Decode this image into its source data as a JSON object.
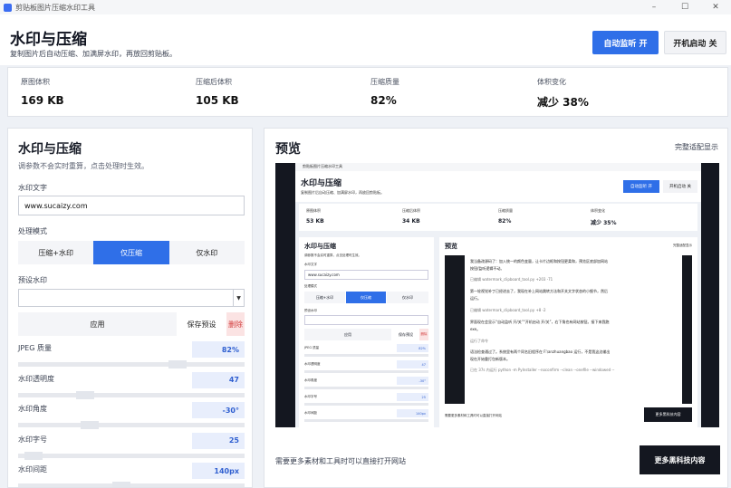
{
  "window": {
    "title": "剪贴板图片压缩水印工具",
    "controls": [
      "–",
      "☐",
      "✕"
    ]
  },
  "header": {
    "title": "水印与压缩",
    "subtitle": "复制图片后自动压缩、加满屏水印，再放回剪贴板。",
    "auto_listen_label": "自动监听  开",
    "boot_label": "开机启动  关"
  },
  "stats": [
    {
      "label": "原图体积",
      "value": "169 KB"
    },
    {
      "label": "压缩后体积",
      "value": "105 KB"
    },
    {
      "label": "压缩质量",
      "value": "82%"
    },
    {
      "label": "体积变化",
      "value": "减少 38%"
    }
  ],
  "left": {
    "title": "水印与压缩",
    "subtitle": "调参数不会实时重算，点击处理时生效。",
    "watermark_text_label": "水印文字",
    "watermark_text_value": "www.sucaizy.com",
    "mode_label": "处理模式",
    "modes": [
      "压缩+水印",
      "仅压缩",
      "仅水印"
    ],
    "active_mode": 1,
    "preset_label": "预设水印",
    "preset_value": "",
    "apply_label": "应用",
    "save_preset_label": "保存预设",
    "delete_label": "删除",
    "sliders": [
      {
        "label": "JPEG 质量",
        "value": "82%",
        "level": 0.72
      },
      {
        "label": "水印透明度",
        "value": "47",
        "level": 0.28
      },
      {
        "label": "水印角度",
        "value": "-30°",
        "level": 0.3
      },
      {
        "label": "水印字号",
        "value": "25",
        "level": 0.03
      },
      {
        "label": "水印间距",
        "value": "140px",
        "level": 0.45
      }
    ]
  },
  "right": {
    "title": "预览",
    "fit_label": "完整适配显示",
    "footer_text": "需要更多素材和工具时可以直接打开网站",
    "more_button": "更多黑科技内容"
  },
  "mini": {
    "window_title": "剪贴板图片压缩水印工具",
    "title": "水印与压缩",
    "subtitle": "复制图片后自动压缩、加满屏水印，再放回剪贴板。",
    "auto_listen_label": "自动监听  开",
    "boot_label": "开机启动  关",
    "stats": [
      {
        "label": "原图体积",
        "value": "53 KB"
      },
      {
        "label": "压缩后体积",
        "value": "34 KB"
      },
      {
        "label": "压缩质量",
        "value": "82%"
      },
      {
        "label": "体积变化",
        "value": "减少 35%"
      }
    ],
    "left_title": "水印与压缩",
    "left_sub": "调参数不会实时重算，点击处理时生效。",
    "text_label": "水印文字",
    "text_value": "www.sucaizy.com",
    "mode_label": "处理模式",
    "modes": [
      "压缩+水印",
      "仅压缩",
      "仅水印"
    ],
    "preset_label": "预设水印",
    "apply": "应用",
    "save": "保存预设",
    "del": "删除",
    "sliders": [
      {
        "label": "JPEG 质量",
        "value": "82%"
      },
      {
        "label": "水印透明度",
        "value": "47"
      },
      {
        "label": "水印角度",
        "value": "-30°"
      },
      {
        "label": "水印字号",
        "value": "25"
      },
      {
        "label": "水印间距",
        "value": "140px"
      }
    ],
    "preview_title": "预览",
    "preview_fit": "完整适配显示",
    "footer_text": "需要更多素材和工具时可以直接打开网站",
    "more_button": "更多黑科技内容",
    "chat_lines": [
      "我当备改源码了：加入统一的颜色变量，让卡片边框和按钮更柔和，预览区底部加网站",
      "按钮/监听逻辑不动。",
      "已编辑 watermark_clipboard_tool.py +203 -71",
      "第一轮视觉补丁已经进去了，我现在补上网站跳转方法和开关文字状态的小细节，然后",
      "运行。",
      "已编辑 watermark_clipboard_tool.py +8 -2",
      "界面现在会显示“自动监听 开/关”“开机启动 开/关”，右下角也有网站按钮。接下来我跑",
      "exe。",
      "运行了命令",
      "语法检查通过了。系统里有两个同名旧程序在 F:\\anzhuangbao 运行，不是我这边输出",
      "现在开始重打包新版本。",
      "已在 37s 内运行 python -m PyInstaller --noconfirm --clean --onefile --windowed --"
    ]
  }
}
